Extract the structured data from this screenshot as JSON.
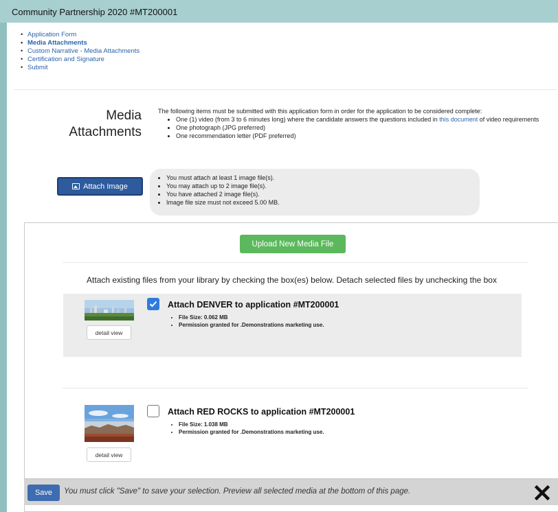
{
  "window": {
    "title": "Community Partnership 2020 #MT200001"
  },
  "nav": {
    "items": [
      {
        "label": "Application Form"
      },
      {
        "label": "Media Attachments"
      },
      {
        "label": "Custom Narrative - Media Attachments"
      },
      {
        "label": "Certification and Signature"
      },
      {
        "label": "Submit"
      }
    ]
  },
  "section": {
    "title_line1": "Media",
    "title_line2": "Attachments",
    "intro": "The following items must be submitted with this application form in order for the application to be considered complete:",
    "requirements": {
      "video_prefix": "One (1) video (from 3 to 6 minutes long) where the candidate answers the questions included in ",
      "video_link": "this document",
      "video_suffix": " of video requirements",
      "photo": "One photograph (JPG preferred)",
      "letter": "One recommendation letter (PDF preferred)"
    }
  },
  "attach": {
    "button_label": "Attach Image",
    "icon": "image-icon",
    "rules": [
      "You must attach at least 1 image file(s).",
      "You may attach up to 2 image file(s).",
      "You have attached 2 image file(s).",
      "Image file size must not exceed 5.00 MB."
    ]
  },
  "modal": {
    "upload_label": "Upload New Media File",
    "instruction": "Attach existing files from your library by checking the box(es) below. Detach selected files by unchecking the box",
    "items": [
      {
        "title": "Attach DENVER to application #MT200001",
        "file_size": "File Size: 0.062 MB",
        "permission": "Permission granted for .Demonstrations marketing use.",
        "detail_label": "detail view",
        "checked": true
      },
      {
        "title": "Attach RED ROCKS to application #MT200001",
        "file_size": "File Size: 1.038 MB",
        "permission": "Permission granted for .Demonstrations marketing use.",
        "detail_label": "detail view",
        "checked": false
      }
    ]
  },
  "footer": {
    "save_label": "Save",
    "message": "You must click \"Save\" to save your selection. Preview all selected media at the bottom of this page.",
    "close_icon": "close-icon"
  },
  "colors": {
    "accent": "#2d5b9e",
    "upload": "#5cb85c",
    "checkbox": "#2e7bde",
    "link": "#2a63ad",
    "frame": "#a8cfcf"
  }
}
